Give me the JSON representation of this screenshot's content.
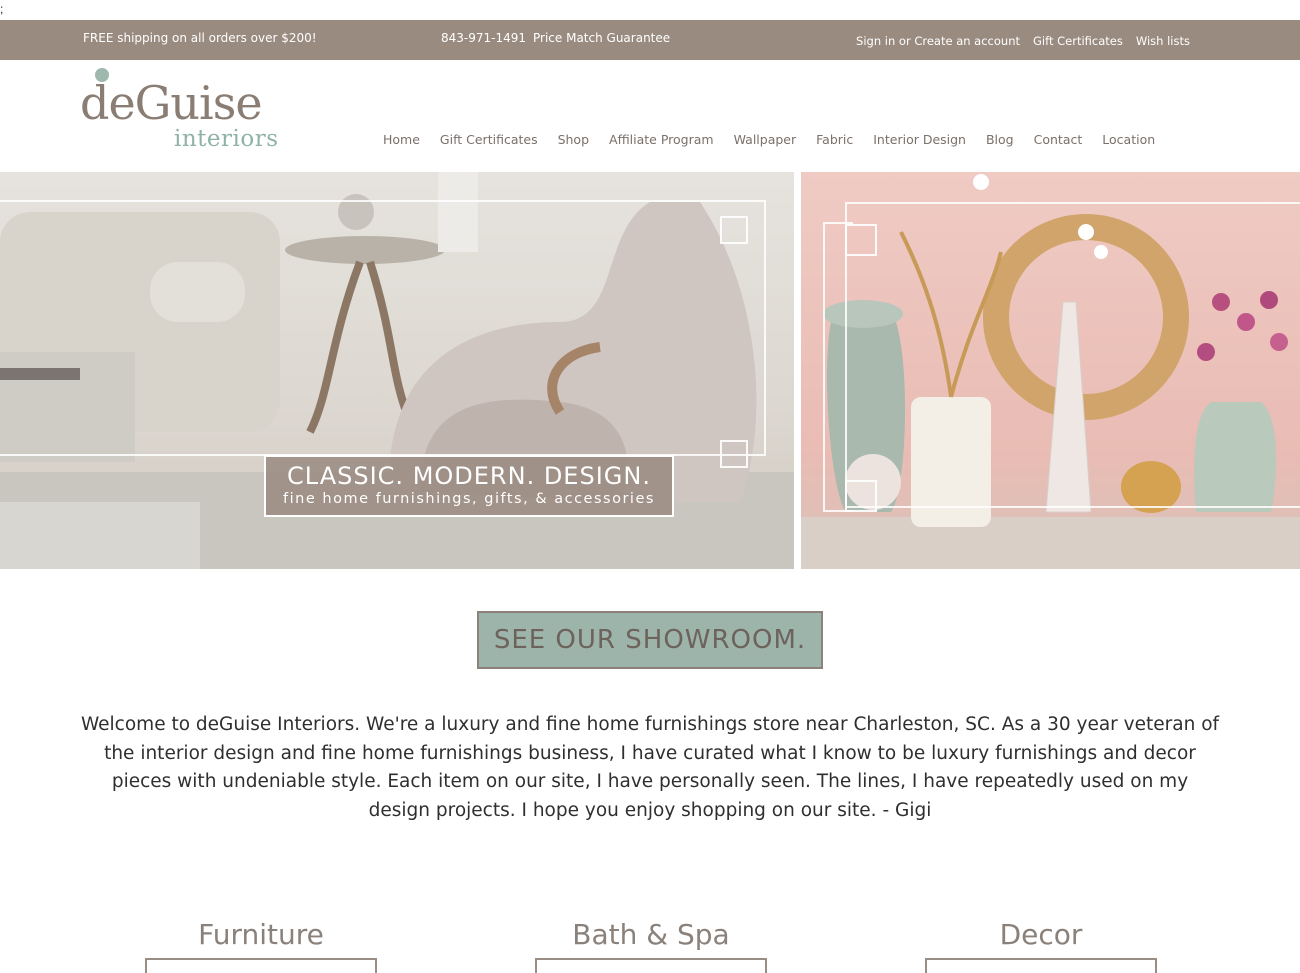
{
  "stray_char": ";",
  "topbar": {
    "shipping": "FREE shipping on all orders over $200!",
    "phone": "843-971-1491",
    "price_match": "Price Match Guarantee",
    "links": [
      "Sign in or Create an account",
      "Gift Certificates",
      "Wish lists"
    ]
  },
  "logo": {
    "wordmark": "deGuise",
    "sub": "interiors"
  },
  "nav": [
    "Home",
    "Gift Certificates",
    "Shop",
    "Affiliate Program",
    "Wallpaper",
    "Fabric",
    "Interior Design",
    "Blog",
    "Contact",
    "Location"
  ],
  "hero": {
    "headline": "CLASSIC. MODERN. DESIGN.",
    "subline": "fine home furnishings, gifts, & accessories"
  },
  "cta": {
    "label": "SEE OUR SHOWROOM."
  },
  "welcome": "Welcome to deGuise Interiors. We're a luxury and fine home furnishings store near Charleston, SC. As a 30 year veteran of the interior design and fine home furnishings business, I have curated what I know to be luxury furnishings and decor pieces with undeniable style. Each item on our site, I have personally seen. The lines, I have repeatedly used on my design projects. I hope you enjoy shopping on our site. - Gigi",
  "categories": [
    "Furniture",
    "Bath & Spa",
    "Decor"
  ],
  "colors": {
    "topbar": "#9a8b80",
    "accent": "#9fb8ad",
    "text": "#7b706a"
  }
}
